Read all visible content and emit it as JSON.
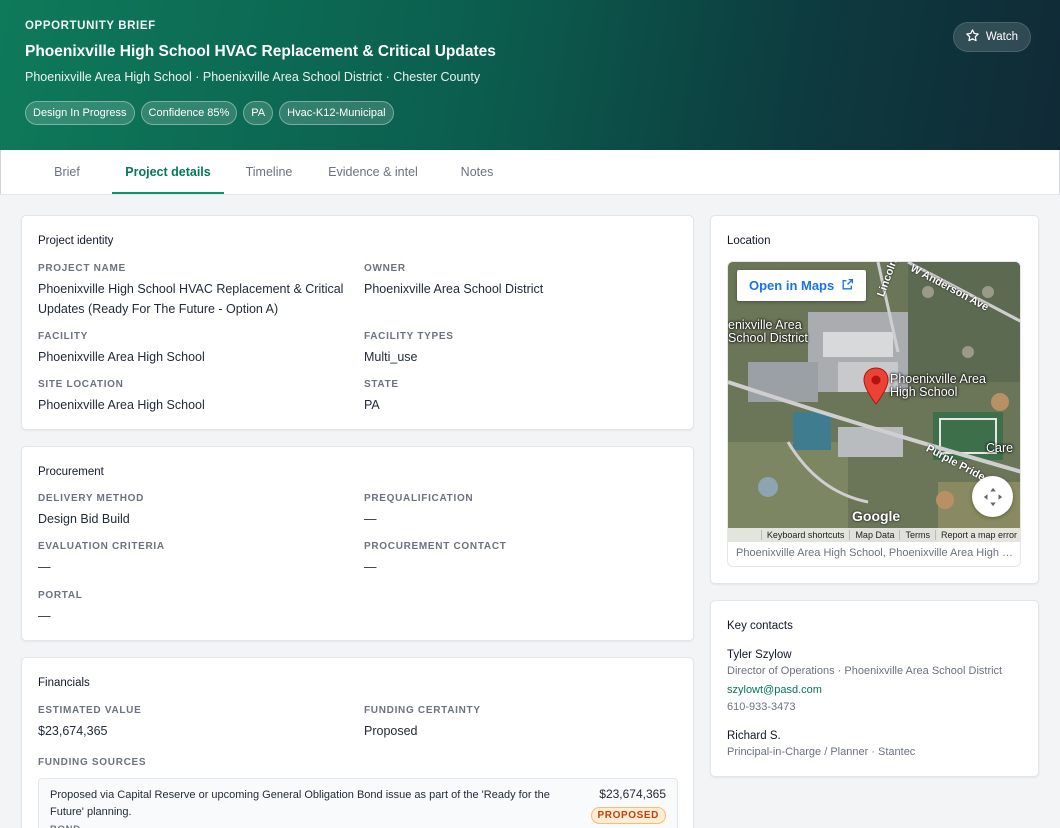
{
  "header": {
    "eyebrow": "OPPORTUNITY BRIEF",
    "title": "Phoenixville High School HVAC Replacement & Critical Updates",
    "subtitle": "Phoenixville Area High School · Phoenixville Area School District · Chester County",
    "chips": [
      "Design In Progress",
      "Confidence 85%",
      "PA",
      "Hvac-K12-Municipal"
    ],
    "watch_label": "Watch"
  },
  "tabs": [
    "Brief",
    "Project details",
    "Timeline",
    "Evidence & intel",
    "Notes"
  ],
  "active_tab": "Project details",
  "project_identity": {
    "title": "Project identity",
    "project_name_label": "PROJECT NAME",
    "project_name_line1": "Phoenixville High School HVAC Replacement & Critical",
    "project_name_line2": "Updates (Ready For The Future - Option A)",
    "owner_label": "OWNER",
    "owner": "Phoenixville Area School District",
    "facility_label": "FACILITY",
    "facility": "Phoenixville Area High School",
    "facility_types_label": "FACILITY TYPES",
    "facility_types": "Multi_use",
    "site_location_label": "SITE LOCATION",
    "site_location": "Phoenixville Area High School",
    "state_label": "STATE",
    "state": "PA"
  },
  "procurement": {
    "title": "Procurement",
    "delivery_method_label": "DELIVERY METHOD",
    "delivery_method": "Design Bid Build",
    "prequalification_label": "PREQUALIFICATION",
    "prequalification": "—",
    "evaluation_criteria_label": "EVALUATION CRITERIA",
    "evaluation_criteria": "—",
    "procurement_contact_label": "PROCUREMENT CONTACT",
    "procurement_contact": "—",
    "portal_label": "PORTAL",
    "portal": "—"
  },
  "financials": {
    "title": "Financials",
    "estimated_value_label": "ESTIMATED VALUE",
    "estimated_value": "$23,674,365",
    "funding_certainty_label": "FUNDING CERTAINTY",
    "funding_certainty": "Proposed",
    "funding_sources_label": "FUNDING SOURCES",
    "source_description": "Proposed via Capital Reserve or upcoming General Obligation Bond issue as part of the 'Ready for the Future' planning.",
    "source_amount": "$23,674,365",
    "source_status": "PROPOSED",
    "source_type": "BOND"
  },
  "location": {
    "title": "Location",
    "open_in_maps": "Open in Maps",
    "place_label_1": "Phoenixville Area",
    "place_label_2": "High School",
    "district_label_1": "enixville Area",
    "district_label_2": "School District",
    "road_1": "Lincoln",
    "road_2": "W Anderson Ave",
    "road_3": "Purple Pride",
    "care_label": "Care",
    "google": "Google",
    "attribution": [
      "Keyboard shortcuts",
      "Map Data",
      "Terms",
      "Report a map error"
    ],
    "caption": "Phoenixville Area High School, Phoenixville Area High School, Phoenixville, PA"
  },
  "contacts": {
    "title": "Key contacts",
    "people": [
      {
        "name": "Tyler Szylow",
        "role": "Director of Operations · Phoenixville Area School District",
        "email": "szylowt@pasd.com",
        "phone": "610-933-3473"
      },
      {
        "name": "Richard S.",
        "role": "Principal-in-Charge / Planner · Stantec"
      }
    ]
  },
  "colors": {
    "accent": "#047857",
    "header_start": "#0e7a5a",
    "header_end": "#102a36",
    "proposed_badge": "#c2410c"
  }
}
